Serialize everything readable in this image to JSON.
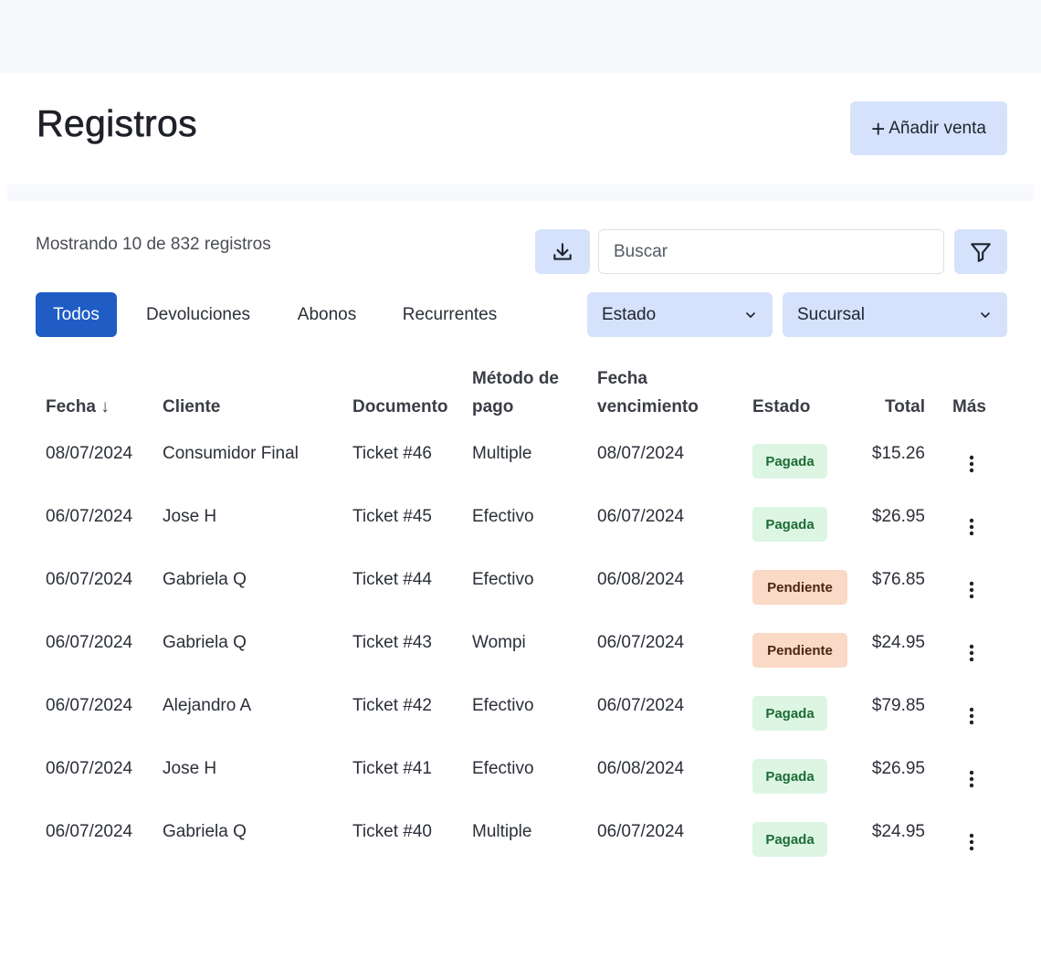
{
  "header": {
    "title": "Registros",
    "add_button_label": "Añadir venta"
  },
  "toolbar": {
    "record_count": "Mostrando 10 de 832 registros",
    "download_icon": "download-icon",
    "search_placeholder": "Buscar",
    "filter_icon": "filter-icon"
  },
  "tabs": [
    {
      "label": "Todos",
      "active": true
    },
    {
      "label": "Devoluciones",
      "active": false
    },
    {
      "label": "Abonos",
      "active": false
    },
    {
      "label": "Recurrentes",
      "active": false
    }
  ],
  "filters": {
    "estado": "Estado",
    "sucursal": "Sucursal"
  },
  "table": {
    "columns": {
      "fecha": "Fecha ↓",
      "cliente": "Cliente",
      "documento": "Documento",
      "metodo_line1": "Método de",
      "metodo_line2": "pago",
      "vencimiento_line1": "Fecha",
      "vencimiento_line2": "vencimiento",
      "estado": "Estado",
      "total": "Total",
      "mas": "Más"
    },
    "rows": [
      {
        "fecha": "08/07/2024",
        "cliente": "Consumidor Final",
        "documento": "Ticket #46",
        "metodo": "Multiple",
        "vencimiento": "08/07/2024",
        "estado": "Pagada",
        "total": "$15.26"
      },
      {
        "fecha": "06/07/2024",
        "cliente": "Jose H",
        "documento": "Ticket #45",
        "metodo": "Efectivo",
        "vencimiento": "06/07/2024",
        "estado": "Pagada",
        "total": "$26.95"
      },
      {
        "fecha": "06/07/2024",
        "cliente": "Gabriela Q",
        "documento": "Ticket #44",
        "metodo": "Efectivo",
        "vencimiento": "06/08/2024",
        "estado": "Pendiente",
        "total": "$76.85"
      },
      {
        "fecha": "06/07/2024",
        "cliente": "Gabriela Q",
        "documento": "Ticket #43",
        "metodo": "Wompi",
        "vencimiento": "06/07/2024",
        "estado": "Pendiente",
        "total": "$24.95"
      },
      {
        "fecha": "06/07/2024",
        "cliente": "Alejandro A",
        "documento": "Ticket #42",
        "metodo": "Efectivo",
        "vencimiento": "06/07/2024",
        "estado": "Pagada",
        "total": "$79.85"
      },
      {
        "fecha": "06/07/2024",
        "cliente": "Jose H",
        "documento": "Ticket #41",
        "metodo": "Efectivo",
        "vencimiento": "06/08/2024",
        "estado": "Pagada",
        "total": "$26.95"
      },
      {
        "fecha": "06/07/2024",
        "cliente": "Gabriela Q",
        "documento": "Ticket #40",
        "metodo": "Multiple",
        "vencimiento": "06/07/2024",
        "estado": "Pagada",
        "total": "$24.95"
      }
    ]
  },
  "colors": {
    "primary": "#1f5dc4",
    "soft_blue": "#d6e2fb",
    "paid_bg": "#dcf6e3",
    "paid_text": "#1e6b36",
    "pending_bg": "#fad9c6",
    "pending_text": "#4a2614"
  }
}
